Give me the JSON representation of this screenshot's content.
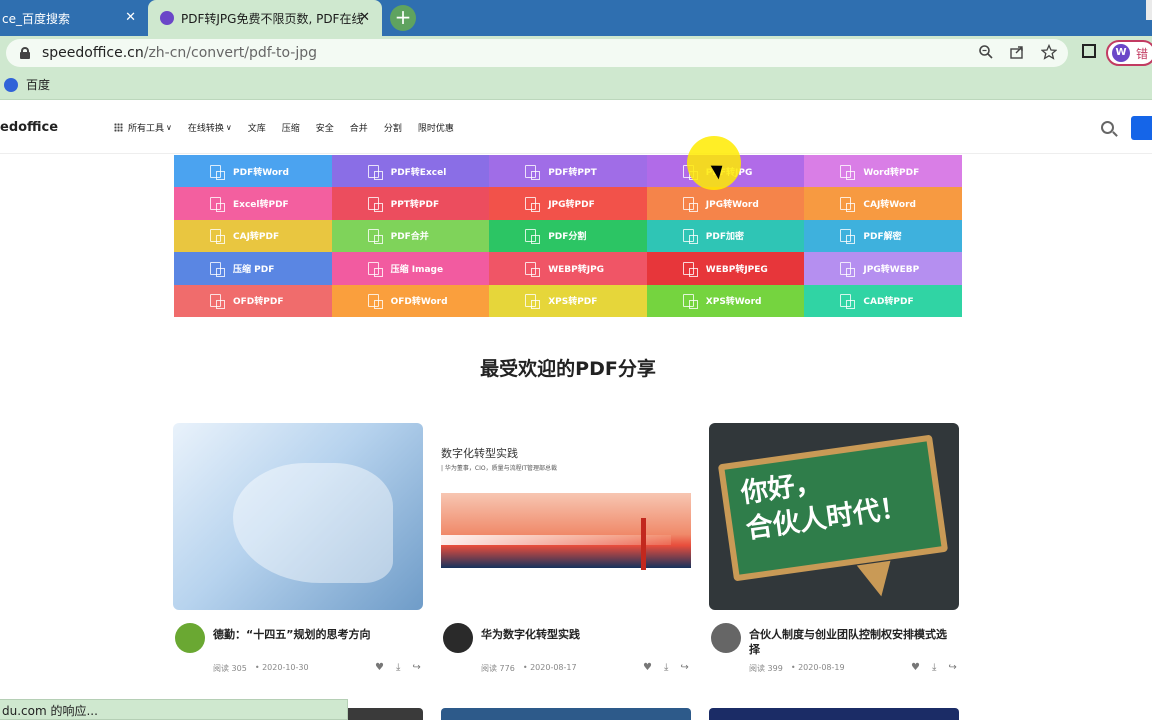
{
  "browser": {
    "tabs": [
      {
        "label": "ce_百度搜索",
        "close": "✕"
      },
      {
        "label": "PDF转JPG免费不限页数, PDF在线",
        "close": "✕"
      }
    ],
    "new_tab": "+",
    "url_host": "speedoffice.cn",
    "url_path": "/zh-cn/convert/pdf-to-jpg",
    "profile_initial": "W",
    "profile_text": "错",
    "bookmark": "百度",
    "status_toast": "du.com 的响应..."
  },
  "site": {
    "logo": "edoffice",
    "nav": [
      {
        "label": "所有工具",
        "has_grid": true,
        "has_chevron": true
      },
      {
        "label": "在线转换",
        "has_grid": false,
        "has_chevron": true
      },
      {
        "label": "文库",
        "has_grid": false,
        "has_chevron": false
      },
      {
        "label": "压缩",
        "has_grid": false,
        "has_chevron": false
      },
      {
        "label": "安全",
        "has_grid": false,
        "has_chevron": false
      },
      {
        "label": "合并",
        "has_grid": false,
        "has_chevron": false
      },
      {
        "label": "分割",
        "has_grid": false,
        "has_chevron": false
      },
      {
        "label": "限时优惠",
        "has_grid": false,
        "has_chevron": false
      }
    ]
  },
  "tools": [
    {
      "label": "PDF转Word",
      "color": "#4ba3f0"
    },
    {
      "label": "PDF转Excel",
      "color": "#8a6ee6"
    },
    {
      "label": "PDF转PPT",
      "color": "#a06de7"
    },
    {
      "label": "PDF转JPG",
      "color": "#b16be8"
    },
    {
      "label": "Word转PDF",
      "color": "#d97ee6"
    },
    {
      "label": "Excel转PDF",
      "color": "#f35f9f"
    },
    {
      "label": "PPT转PDF",
      "color": "#ec4d5e"
    },
    {
      "label": "JPG转PDF",
      "color": "#f2524a"
    },
    {
      "label": "JPG转Word",
      "color": "#f5844a"
    },
    {
      "label": "CAJ转Word",
      "color": "#f79a41"
    },
    {
      "label": "CAJ转PDF",
      "color": "#e9c640"
    },
    {
      "label": "PDF合并",
      "color": "#7fd35a"
    },
    {
      "label": "PDF分割",
      "color": "#2cc564"
    },
    {
      "label": "PDF加密",
      "color": "#2fc5b5"
    },
    {
      "label": "PDF解密",
      "color": "#3eb1dd"
    },
    {
      "label": "压缩 PDF",
      "color": "#5a86e3"
    },
    {
      "label": "压缩 Image",
      "color": "#f25ba0"
    },
    {
      "label": "WEBP转JPG",
      "color": "#f05566"
    },
    {
      "label": "WEBP转JPEG",
      "color": "#e7363a"
    },
    {
      "label": "JPG转WEBP",
      "color": "#b58ff0"
    },
    {
      "label": "OFD转PDF",
      "color": "#f06c6c"
    },
    {
      "label": "OFD转Word",
      "color": "#fa9f3d"
    },
    {
      "label": "XPS转PDF",
      "color": "#e6d63a"
    },
    {
      "label": "XPS转Word",
      "color": "#75d43f"
    },
    {
      "label": "CAD转PDF",
      "color": "#30d4a4"
    }
  ],
  "section_title": "最受欢迎的PDF分享",
  "cards": [
    {
      "title": "德勤：“十四五”规划的思考方向",
      "reads": "阅读 305",
      "date": "2020-10-30",
      "avatar_color": "#6aa832"
    },
    {
      "title": "华为数字化转型实践",
      "reads": "阅读 776",
      "date": "2020-08-17",
      "avatar_color": "#2a2a2a",
      "image_headline": "数字化转型实践",
      "image_sub": "| 华为董事，CIO，质量与流程IT管理部总裁"
    },
    {
      "title": "合伙人制度与创业团队控制权安排模式选择",
      "reads": "阅读 399",
      "date": "2020-08-19",
      "avatar_color": "#666666",
      "image_text_1": "你好，",
      "image_text_2": "合伙人时代！"
    }
  ],
  "card_actions": {
    "like": "♥",
    "download": "⤓",
    "share": "↪"
  },
  "toolbar_icons": {
    "zoom": "zoom-icon",
    "share": "share-icon",
    "star": "star-icon"
  }
}
